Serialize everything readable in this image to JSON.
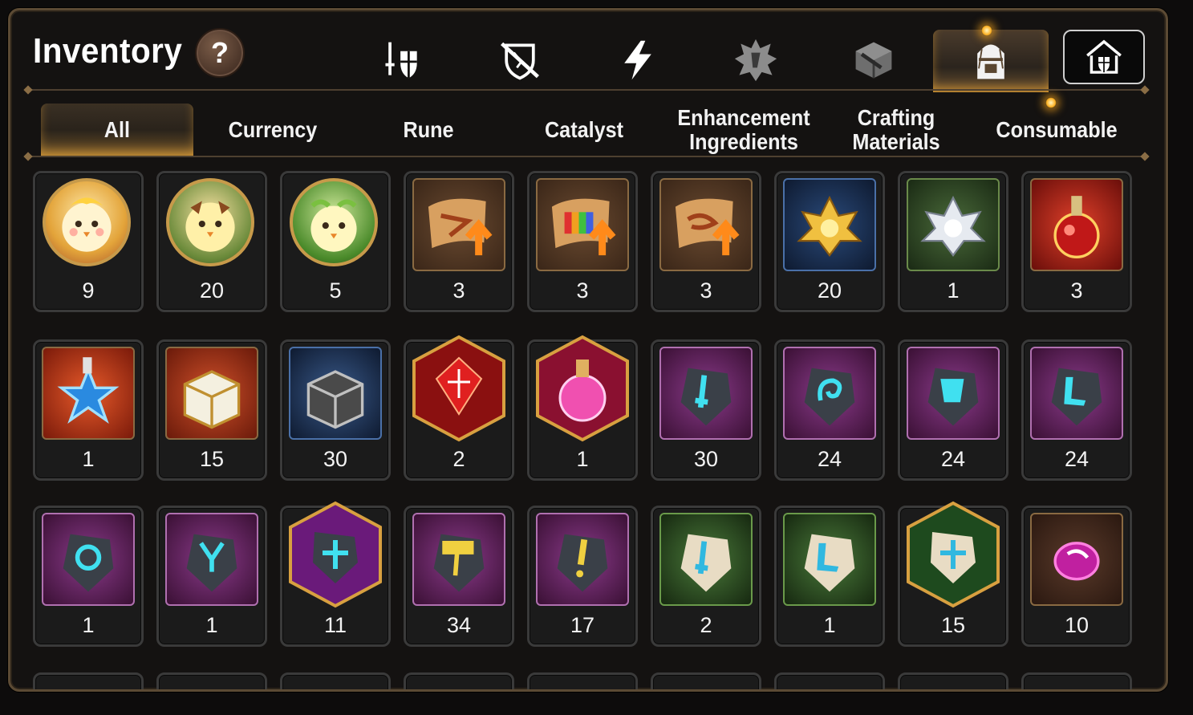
{
  "header": {
    "title": "Inventory",
    "help_label": "?"
  },
  "category_tabs": [
    {
      "icon": "sword-shield-icon"
    },
    {
      "icon": "broken-shield-icon"
    },
    {
      "icon": "lightning-icon"
    },
    {
      "icon": "spiky-badge-icon"
    },
    {
      "icon": "cube-icon"
    },
    {
      "icon": "backpack-icon",
      "active": true
    },
    {
      "icon": "house-shield-icon"
    }
  ],
  "sub_tabs": [
    "All",
    "Currency",
    "Rune",
    "Catalyst",
    "Enhancement Ingredients",
    "Crafting Materials",
    "Consumable"
  ],
  "active_sub_tab": "All",
  "items_row1": [
    {
      "icon": "yellow-chick-round-icon",
      "qty": "9"
    },
    {
      "icon": "chick-round-icon",
      "qty": "20"
    },
    {
      "icon": "green-chick-round-icon",
      "qty": "5"
    },
    {
      "icon": "scroll-upgrade-icon",
      "qty": "3"
    },
    {
      "icon": "rainbow-scroll-upgrade-icon",
      "qty": "3"
    },
    {
      "icon": "scroll-upgrade-icon",
      "qty": "3"
    },
    {
      "icon": "gold-crystal-flower-icon",
      "qty": "20"
    },
    {
      "icon": "silver-crystal-flower-icon",
      "qty": "1"
    },
    {
      "icon": "red-potion-icon",
      "qty": "3"
    }
  ],
  "items_row2": [
    {
      "icon": "star-potion-icon",
      "qty": "1"
    },
    {
      "icon": "gold-chest-icon",
      "qty": "15"
    },
    {
      "icon": "silver-chest-icon",
      "qty": "30"
    },
    {
      "icon": "red-gem-hex-icon",
      "qty": "2"
    },
    {
      "icon": "pink-potion-hex-icon",
      "qty": "1"
    },
    {
      "icon": "sword-rune-stone-icon",
      "qty": "30"
    },
    {
      "icon": "swirl-rune-stone-icon",
      "qty": "24"
    },
    {
      "icon": "armor-rune-stone-icon",
      "qty": "24"
    },
    {
      "icon": "boot-rune-stone-icon",
      "qty": "24"
    }
  ],
  "items_row3": [
    {
      "icon": "ring-rune-stone-icon",
      "qty": "1"
    },
    {
      "icon": "necklace-rune-stone-icon",
      "qty": "1"
    },
    {
      "icon": "star-rune-hex-icon",
      "qty": "11"
    },
    {
      "icon": "hammer-rune-stone-icon",
      "qty": "34"
    },
    {
      "icon": "exclaim-rune-stone-icon",
      "qty": "17"
    },
    {
      "icon": "sword-white-stone-icon",
      "qty": "2"
    },
    {
      "icon": "boot-white-stone-icon",
      "qty": "1"
    },
    {
      "icon": "star-white-stone-hex-icon",
      "qty": "15"
    },
    {
      "icon": "pink-orb-icon",
      "qty": "10"
    }
  ],
  "colors": {
    "accent_gold": "#e2a23a",
    "frame_brown": "#5b4a34",
    "background": "#141211"
  }
}
